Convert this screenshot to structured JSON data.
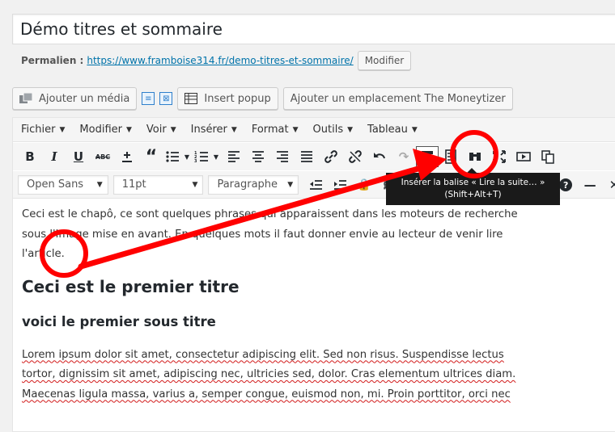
{
  "post": {
    "title": "Démo titres et sommaire",
    "permalink_label": "Permalien :",
    "permalink_url": "https://www.framboise314.fr/demo-titres-et-sommaire/",
    "modify_button": "Modifier"
  },
  "media_bar": {
    "add_media": "Ajouter un média",
    "insert_popup": "Insert popup",
    "moneytizer": "Ajouter un emplacement The Moneytizer"
  },
  "menubar": {
    "items": [
      "Fichier",
      "Modifier",
      "Voir",
      "Insérer",
      "Format",
      "Outils",
      "Tableau"
    ]
  },
  "toolbar2": {
    "font_family": "Open Sans",
    "font_size": "11pt",
    "paragraph_format": "Paragraphe"
  },
  "tooltip": {
    "line1": "Insérer la balise « Lire la suite… »",
    "line2": "(Shift+Alt+T)"
  },
  "content": {
    "intro_line1": "Ceci est le chapô, ce sont quelques phrases qui apparaissent dans les moteurs de recherche",
    "intro_line2": "sous l'image mise en avant. En quelques mots il faut donner envie au lecteur de venir lire",
    "intro_line3": "l'article.",
    "heading1": "Ceci est le premier titre",
    "heading2": "voici le premier sous titre",
    "lorem_line1": "Lorem ipsum dolor sit amet, consectetur adipiscing elit. Sed non risus. Suspendisse lectus",
    "lorem_line2": "tortor, dignissim sit amet, adipiscing nec, ultricies sed, dolor. Cras elementum ultrices diam.",
    "lorem_line3": "Maecenas ligula massa, varius a, semper congue, euismod non, mi. Proin porttitor, orci nec"
  },
  "annotation": {
    "color": "#ff0000"
  }
}
